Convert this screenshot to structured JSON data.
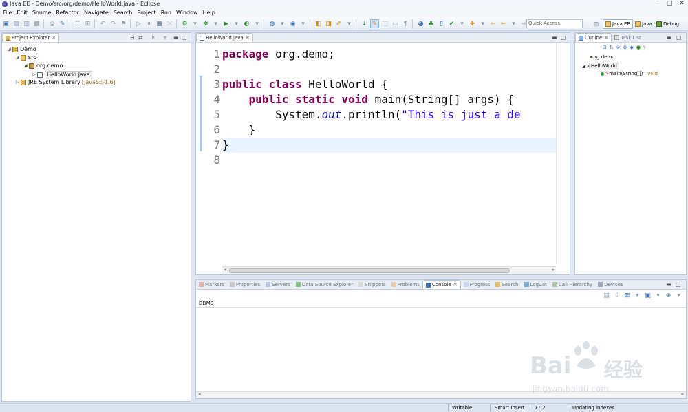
{
  "window": {
    "title": "Java EE - Demo/src/org/demo/HelloWorld.java - Eclipse",
    "controls": [
      "–",
      "□",
      "✕"
    ]
  },
  "menu": [
    "File",
    "Edit",
    "Source",
    "Refactor",
    "Navigate",
    "Search",
    "Project",
    "Run",
    "Window",
    "Help"
  ],
  "toolbar": {
    "quick_access_placeholder": "Quick Access",
    "perspectives": [
      {
        "label": "Java EE",
        "active": true
      },
      {
        "label": "Java",
        "active": false
      },
      {
        "label": "Debug",
        "active": false
      }
    ]
  },
  "project_explorer": {
    "tab_label": "Project Explorer",
    "tree": [
      {
        "label": "Demo",
        "icon": "project-icon"
      },
      {
        "label": "src",
        "icon": "source-folder-icon"
      },
      {
        "label": "org.demo",
        "icon": "package-icon"
      },
      {
        "label": "HelloWorld.java",
        "icon": "java-file-icon",
        "selected": true
      },
      {
        "label": "JRE System Library",
        "tag": "[JavaSE-1.6]",
        "icon": "library-icon"
      }
    ]
  },
  "editor": {
    "tab_label": "HelloWorld.java",
    "current_line": 7,
    "lines": [
      {
        "no": "1",
        "tokens": [
          {
            "t": "package",
            "k": "kw"
          },
          {
            "t": " org.demo;",
            "k": ""
          }
        ]
      },
      {
        "no": "2",
        "tokens": []
      },
      {
        "no": "3",
        "tokens": [
          {
            "t": "public",
            "k": "kw"
          },
          {
            "t": " ",
            "k": ""
          },
          {
            "t": "class",
            "k": "kw"
          },
          {
            "t": " HelloWorld {",
            "k": ""
          }
        ]
      },
      {
        "no": "4",
        "tokens": [
          {
            "t": "    ",
            "k": ""
          },
          {
            "t": "public",
            "k": "kw"
          },
          {
            "t": " ",
            "k": ""
          },
          {
            "t": "static",
            "k": "kw"
          },
          {
            "t": " ",
            "k": ""
          },
          {
            "t": "void",
            "k": "kw"
          },
          {
            "t": " main(String[] args) {",
            "k": ""
          }
        ]
      },
      {
        "no": "5",
        "tokens": [
          {
            "t": "        System.",
            "k": ""
          },
          {
            "t": "out",
            "k": "fld"
          },
          {
            "t": ".println(",
            "k": ""
          },
          {
            "t": "\"This is just a de",
            "k": "str"
          }
        ]
      },
      {
        "no": "6",
        "tokens": [
          {
            "t": "    }",
            "k": ""
          }
        ]
      },
      {
        "no": "7",
        "tokens": [
          {
            "t": "}",
            "k": ""
          }
        ]
      },
      {
        "no": "8",
        "tokens": []
      }
    ]
  },
  "outline": {
    "tabs": [
      {
        "label": "Outline",
        "active": true
      },
      {
        "label": "Task List",
        "active": false
      }
    ],
    "items": [
      {
        "label": "org.demo",
        "icon": "package-icon"
      },
      {
        "label": "HelloWorld",
        "icon": "class-icon",
        "selected": true
      },
      {
        "label": "main(String[])",
        "ret": ": void",
        "icon": "method-icon"
      }
    ]
  },
  "bottom_panel": {
    "tabs": [
      {
        "label": "Markers",
        "active": false
      },
      {
        "label": "Properties",
        "active": false
      },
      {
        "label": "Servers",
        "active": false
      },
      {
        "label": "Data Source Explorer",
        "active": false
      },
      {
        "label": "Snippets",
        "active": false
      },
      {
        "label": "Problems",
        "active": false
      },
      {
        "label": "Console",
        "active": true
      },
      {
        "label": "Progress",
        "active": false
      },
      {
        "label": "Search",
        "active": false
      },
      {
        "label": "LogCat",
        "active": false
      },
      {
        "label": "Call Hierarchy",
        "active": false
      },
      {
        "label": "Devices",
        "active": false
      }
    ],
    "console_name": "DDMS"
  },
  "status": {
    "writable": "Writable",
    "insert_mode": "Smart Insert",
    "position": "7 : 2",
    "task": "Updating indexes"
  },
  "watermark": {
    "brand": "Bai",
    "brand_cn": "经验",
    "url": "jingyan.baidu.com"
  },
  "colors": {
    "keyword": "#7f0055",
    "string": "#2a00ff",
    "field": "#0000c0",
    "current_line": "#e8f2fe"
  }
}
